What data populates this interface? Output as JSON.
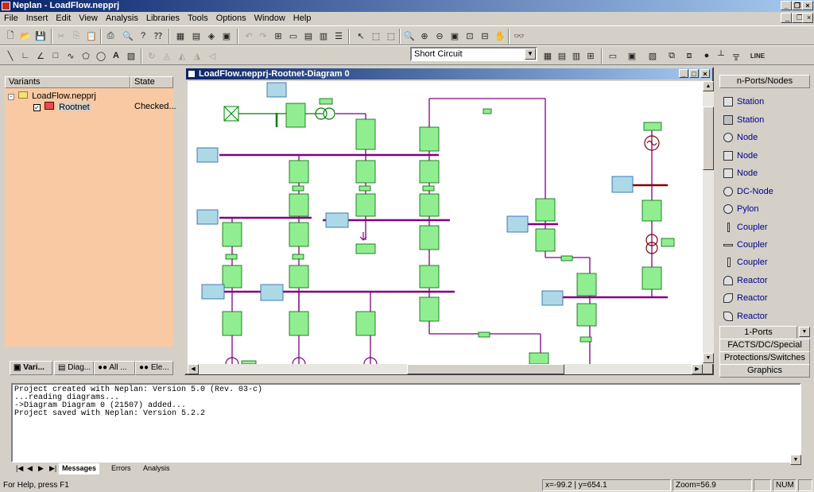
{
  "window": {
    "title": "Neplan - LoadFlow.nepprj"
  },
  "menu": [
    "File",
    "Insert",
    "Edit",
    "View",
    "Analysis",
    "Libraries",
    "Tools",
    "Options",
    "Window",
    "Help"
  ],
  "toolbar": {
    "analysis_mode": "Short Circuit",
    "line_label": "LINE"
  },
  "variants": {
    "col_variants": "Variants",
    "col_state": "State",
    "project": "LoadFlow.nepprj",
    "net": "Rootnet",
    "net_state": "Checked...",
    "tabs": [
      "Vari...",
      "Diag...",
      "All ...",
      "Ele..."
    ]
  },
  "diagram": {
    "title": "LoadFlow.nepprj-Rootnet-Diagram 0"
  },
  "symbols": {
    "header": "n-Ports/Nodes",
    "items": [
      "Station",
      "Station",
      "Node",
      "Node",
      "Node",
      "DC-Node",
      "Pylon",
      "Coupler",
      "Coupler",
      "Coupler",
      "Reactor",
      "Reactor",
      "Reactor"
    ],
    "sections": [
      "1-Ports",
      "FACTS/DC/Special",
      "Protections/Switches",
      "Graphics"
    ]
  },
  "messages": {
    "lines": [
      "Project created with Neplan: Version 5.0 (Rev. 03-c)",
      "...reading diagrams...",
      "->Diagram Diagram 0 (21507) added...",
      "Project saved with Neplan: Version 5.2.2"
    ],
    "tabs": [
      "Messages",
      "Errors",
      "Analysis"
    ]
  },
  "status": {
    "help": "For Help, press F1",
    "coords": "x=-99.2 | y=654.1",
    "zoom": "Zoom=56.9",
    "num": "NUM"
  }
}
